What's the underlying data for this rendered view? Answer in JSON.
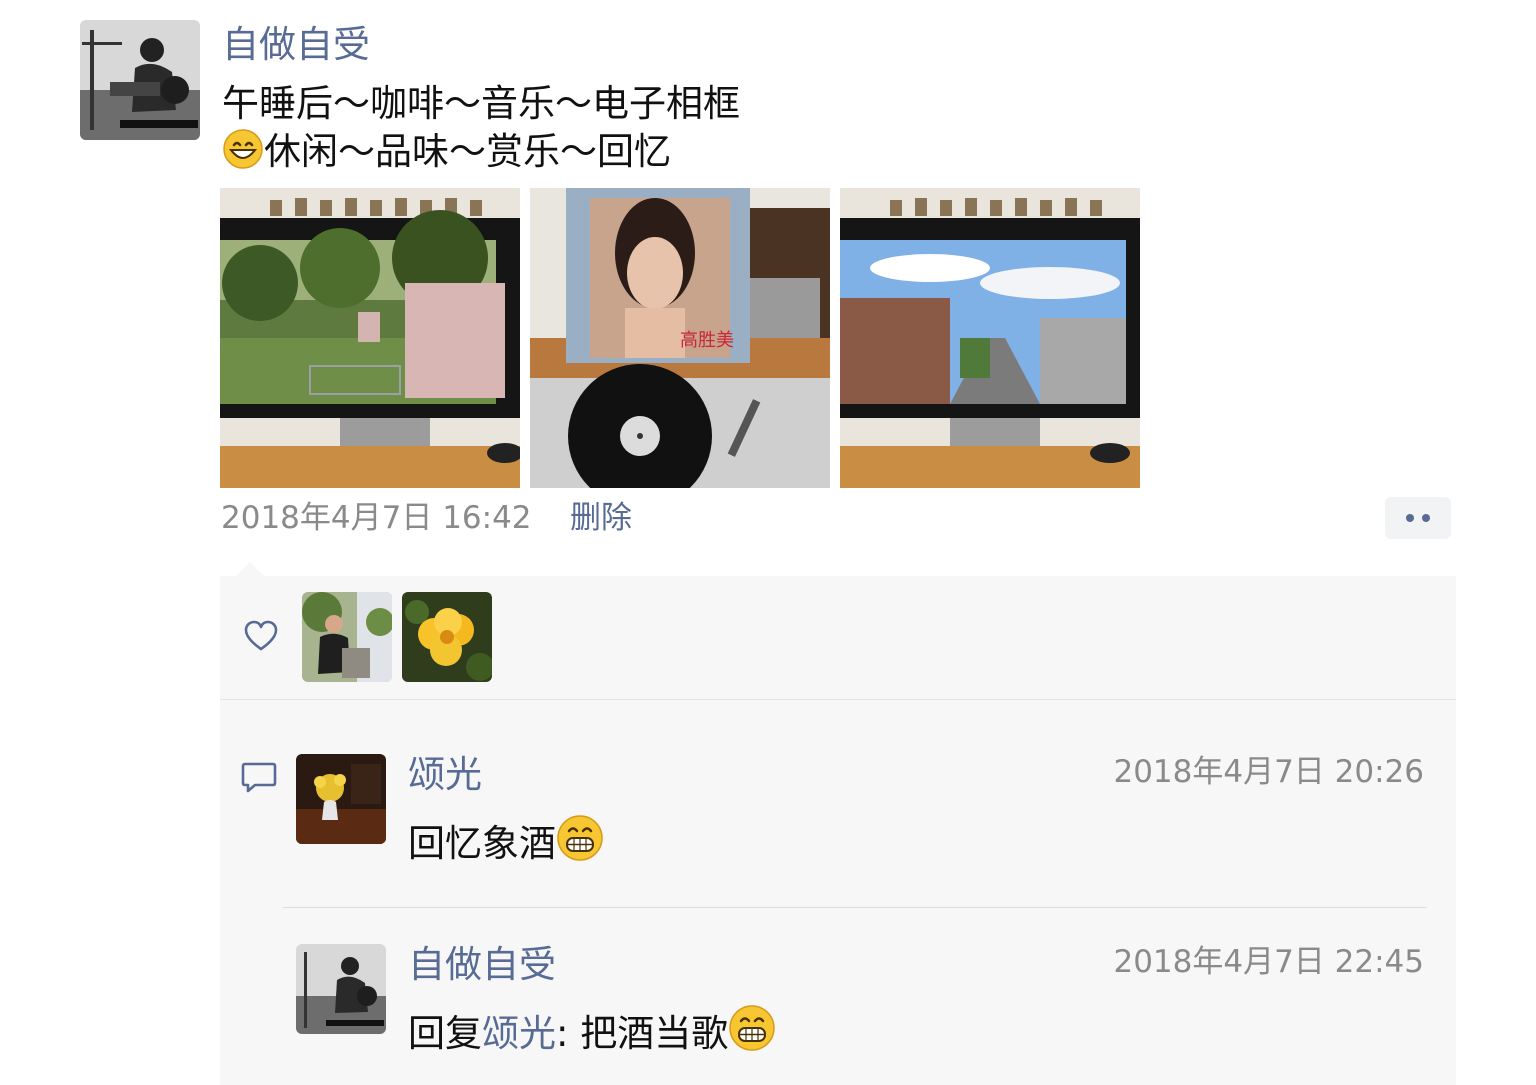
{
  "post": {
    "author": "自做自受",
    "avatar_icon": "bw-photo-avatar",
    "text_line1": "午睡后～咖啡～音乐～电子相框",
    "text_line2_emoji": "grinning-face-emoji",
    "text_line2": "休闲～品味～赏乐～回忆",
    "images": [
      {
        "name": "photo-tv-park"
      },
      {
        "name": "photo-record-player"
      },
      {
        "name": "photo-tv-street"
      }
    ],
    "timestamp": "2018年4月7日 16:42",
    "delete_label": "删除",
    "more_icon": "more-dots-icon"
  },
  "likes": {
    "icon": "heart-icon",
    "avatars": [
      {
        "name": "like-avatar-man-outdoors"
      },
      {
        "name": "like-avatar-yellow-flower"
      }
    ]
  },
  "comments": [
    {
      "author": "颂光",
      "time": "2018年4月7日 20:26",
      "text": "回忆象酒",
      "emoji": "grin-emoji"
    },
    {
      "author": "自做自受",
      "time": "2018年4月7日 22:45",
      "reply_prefix": "回复",
      "reply_to": "颂光",
      "reply_sep": ": ",
      "text": "把酒当歌",
      "emoji": "grin-emoji"
    }
  ],
  "colors": {
    "link": "#576b95",
    "meta": "#8a8a8a",
    "panel": "#f7f7f7"
  }
}
